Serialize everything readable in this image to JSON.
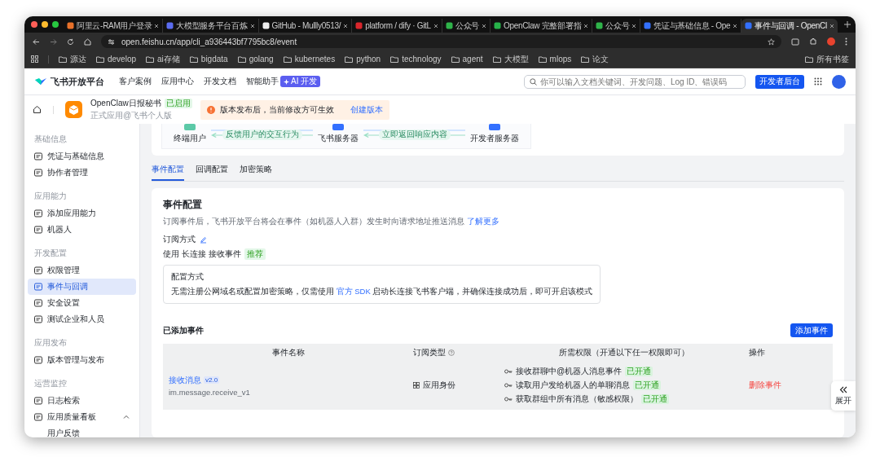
{
  "browser": {
    "tabs": [
      {
        "title": "阿里云-RAM用户登录",
        "selected": false
      },
      {
        "title": "大模型服务平台百炼",
        "selected": false
      },
      {
        "title": "GitHub - Mullly0513/",
        "selected": false
      },
      {
        "title": "platform / dify · GitL",
        "selected": false
      },
      {
        "title": "公众号",
        "selected": false
      },
      {
        "title": "OpenClaw 完整部署指",
        "selected": false
      },
      {
        "title": "公众号",
        "selected": false
      },
      {
        "title": "凭证与基础信息 - Ope",
        "selected": false
      },
      {
        "title": "事件与回调 - OpenCl",
        "selected": true
      }
    ],
    "url": "open.feishu.cn/app/cli_a936443bf7795bc8/event",
    "bookmarks": [
      "源达",
      "develop",
      "ai存储",
      "bigdata",
      "golang",
      "kubernetes",
      "python",
      "technology",
      "agent",
      "大模型",
      "mlops",
      "论文"
    ],
    "all_bookmarks": "所有书签"
  },
  "header": {
    "logo": "飞书开放平台",
    "nav": [
      "客户案例",
      "应用中心",
      "开发文档",
      "智能助手"
    ],
    "ai_badge": "AI 开发",
    "search": {
      "placeholder": "你可以输入文档关键词、开发问题、Log ID、错误码"
    },
    "console_button": "开发者后台"
  },
  "app_bar": {
    "name": "OpenClaw日报秘书",
    "status": "已启用",
    "subtitle": "正式应用@飞书个人版",
    "notice": "版本发布后，当前修改方可生效",
    "notice_link": "创建版本"
  },
  "sidebar": {
    "sections": [
      {
        "title": "基础信息",
        "items": [
          {
            "label": "凭证与基础信息",
            "selected": false
          },
          {
            "label": "协作者管理",
            "selected": false
          }
        ]
      },
      {
        "title": "应用能力",
        "items": [
          {
            "label": "添加应用能力",
            "selected": false
          },
          {
            "label": "机器人",
            "selected": false
          }
        ]
      },
      {
        "title": "开发配置",
        "items": [
          {
            "label": "权限管理",
            "selected": false
          },
          {
            "label": "事件与回调",
            "selected": true
          },
          {
            "label": "安全设置",
            "selected": false
          },
          {
            "label": "测试企业和人员",
            "selected": false
          }
        ]
      },
      {
        "title": "应用发布",
        "items": [
          {
            "label": "版本管理与发布",
            "selected": false
          }
        ]
      },
      {
        "title": "运营监控",
        "items": [
          {
            "label": "日志检索",
            "selected": false
          },
          {
            "label": "应用质量看板",
            "selected": false,
            "expanded": true,
            "children": [
              {
                "label": "用户反馈",
                "selected": false
              }
            ]
          }
        ]
      }
    ]
  },
  "diagram": {
    "nodes": [
      "终端用户",
      "飞书服务器",
      "开发者服务器"
    ],
    "flows": [
      "反馈用户的交互行为",
      "立即返回响应内容"
    ]
  },
  "tabs": [
    {
      "label": "事件配置",
      "selected": true
    },
    {
      "label": "回调配置",
      "selected": false
    },
    {
      "label": "加密策略",
      "selected": false
    }
  ],
  "event_config": {
    "title": "事件配置",
    "description": "订阅事件后，飞书开放平台将会在事件（如机器人入群）发生时向请求地址推送消息",
    "learn_more": "了解更多",
    "mode_label": "订阅方式",
    "mode_prefix": "使用",
    "mode_value": "长连接",
    "mode_suffix": "接收事件",
    "mode_tag": "推荐",
    "box_title": "配置方式",
    "box_text_before": "无需注册公网域名或配置加密策略，仅需使用",
    "box_link": "官方 SDK",
    "box_text_after": "启动长连接飞书客户端，并确保连接成功后，即可开启该模式"
  },
  "events": {
    "title": "已添加事件",
    "add_button": "添加事件",
    "columns": [
      "事件名称",
      "订阅类型",
      "所需权限（开通以下任一权限即可）",
      "操作"
    ],
    "rows": [
      {
        "name": "接收消息",
        "version": "v2.0",
        "code": "im.message.receive_v1",
        "type": "应用身份",
        "permissions": [
          {
            "label": "接收群聊中@机器人消息事件",
            "status": "已开通"
          },
          {
            "label": "读取用户发给机器人的单聊消息",
            "status": "已开通"
          },
          {
            "label": "获取群组中所有消息（敏感权限）",
            "status": "已开通"
          }
        ],
        "action": "删除事件"
      }
    ]
  },
  "expand_button": "展开"
}
